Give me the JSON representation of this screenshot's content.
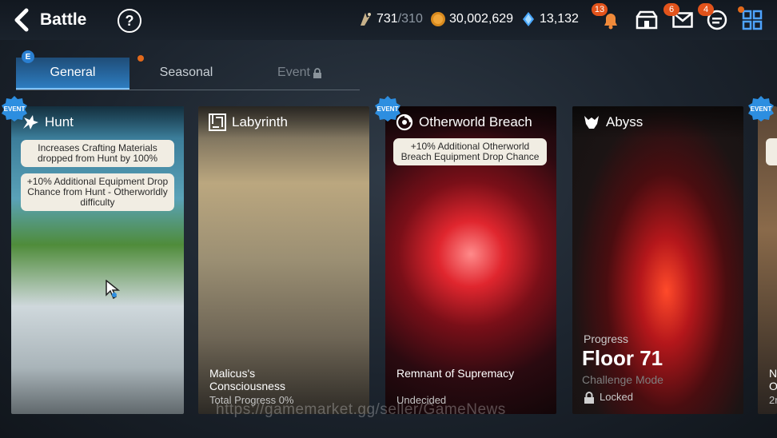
{
  "header": {
    "title": "Battle",
    "help": "?",
    "stamina_value": "731",
    "stamina_max": "/310",
    "gold": "30,002,629",
    "skystones": "13,132",
    "notifications_badge": "13",
    "mail_badge": "6",
    "chat_badge": "4"
  },
  "tabs": {
    "general": "General",
    "general_badge": "E",
    "seasonal": "Seasonal",
    "event": "Event"
  },
  "cards": {
    "hunt": {
      "event_badge": "EVENT",
      "title": "Hunt",
      "info1": "Increases Crafting Materials dropped from Hunt by 100%",
      "info2": "+10% Additional Equipment Drop Chance from Hunt - Otherworldly difficulty"
    },
    "labyrinth": {
      "title": "Labyrinth",
      "name": "Malicus's Consciousness",
      "progress": "Total Progress 0%"
    },
    "breach": {
      "event_badge": "EVENT",
      "title": "Otherworld Breach",
      "info": "+10% Additional Otherworld Breach Equipment Drop Chance",
      "name": "Remnant of Supremacy",
      "status": "Undecided"
    },
    "abyss": {
      "title": "Abyss",
      "progress_label": "Progress",
      "floor": "Floor 71",
      "mode": "Challenge Mode",
      "locked": "Locked"
    },
    "partial": {
      "event_badge": "EVENT",
      "line1": "N",
      "line2": "O",
      "line3": "2r"
    }
  },
  "watermark": "https://gamemarket.gg/seller/GameNews"
}
